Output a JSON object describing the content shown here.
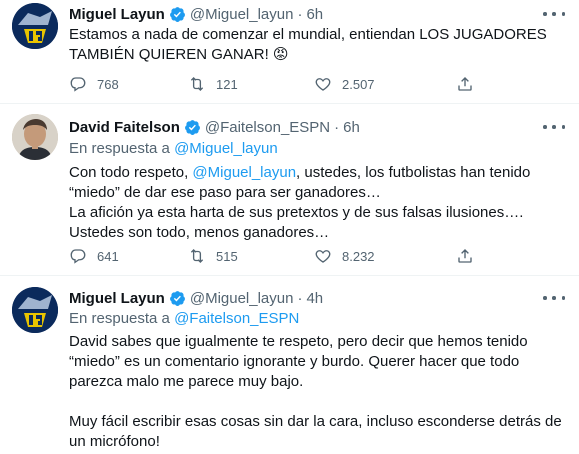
{
  "tweets": [
    {
      "name": "Miguel Layun",
      "handle": "@Miguel_layun",
      "dot": "·",
      "time": "6h",
      "text_lines": [
        "Estamos a nada de comenzar el mundial, entiendan LOS JUGADORES",
        "TAMBIÉN QUIEREN GANAR! 😡"
      ],
      "replies": "768",
      "retweets": "121",
      "likes": "2.507"
    },
    {
      "name": "David Faitelson",
      "handle": "@Faitelson_ESPN",
      "dot": "·",
      "time": "6h",
      "reply_prefix": "En respuesta a",
      "reply_to": "@Miguel_layun",
      "text_line1_pre": "Con todo respeto, ",
      "text_line1_mention": "@Miguel_layun",
      "text_line1_post": ", ustedes, los futbolistas han tenido",
      "text_lines": [
        "“miedo” de dar ese paso para ser ganadores…",
        "La afición ya esta harta de sus pretextos y de sus falsas ilusiones….",
        "Ustedes son todo, menos ganadores…"
      ],
      "replies": "641",
      "retweets": "515",
      "likes": "8.232"
    },
    {
      "name": "Miguel Layun",
      "handle": "@Miguel_layun",
      "dot": "·",
      "time": "4h",
      "reply_prefix": "En respuesta a",
      "reply_to": "@Faitelson_ESPN",
      "text_lines": [
        "David sabes que igualmente te respeto, pero decir que hemos tenido",
        "“miedo” es un comentario ignorante y burdo. Querer hacer que todo",
        "parezca malo me parece muy bajo.",
        "",
        "Muy fácil escribir esas cosas sin dar la cara, incluso esconderse detrás de",
        "un micrófono!"
      ]
    }
  ],
  "icons": {
    "more": "more-horizontal-icon",
    "reply": "reply-icon",
    "retweet": "retweet-icon",
    "like": "heart-icon",
    "share": "share-icon",
    "verified": "verified-badge-icon"
  },
  "colors": {
    "text": "#0f1419",
    "secondary": "#536471",
    "link": "#1d9bf0",
    "divider": "#eff3f4"
  }
}
